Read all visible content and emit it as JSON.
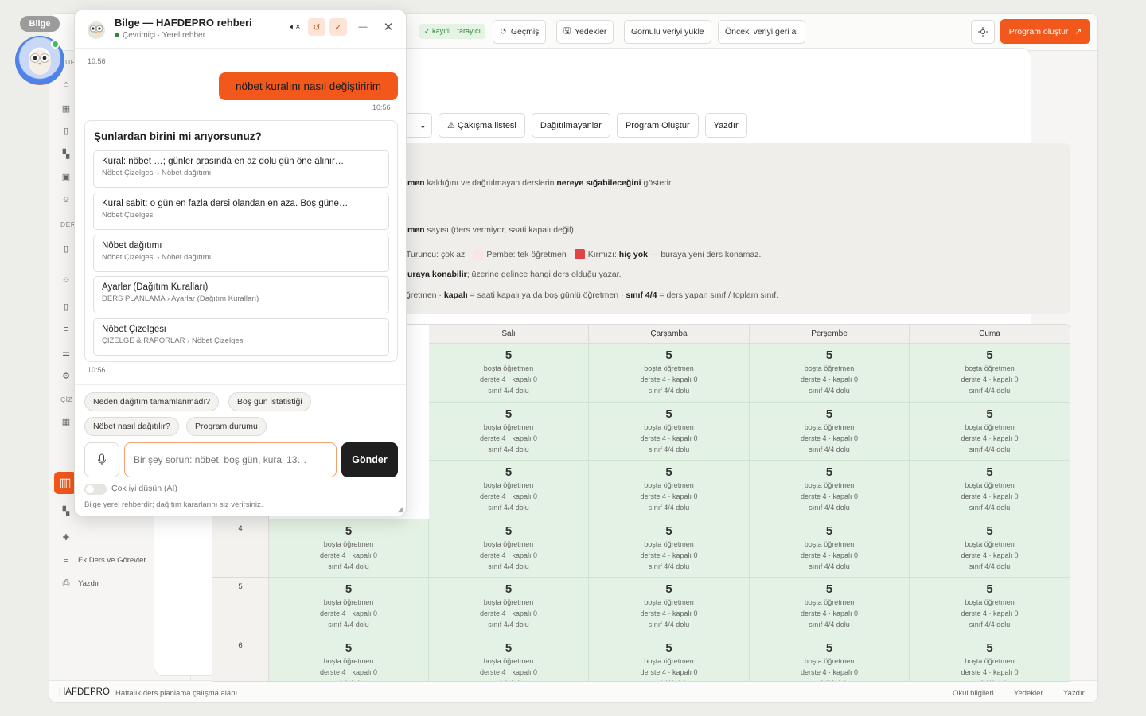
{
  "topbar": {
    "status_badge": "✓ kayıtlı · tarayıcı",
    "history": "Geçmiş",
    "backups": "Yedekler",
    "load_embedded": "Gömülü veriyi yükle",
    "restore_previous": "Önceki veriyi geri al",
    "create_program": "Program oluştur"
  },
  "sidebar": {
    "section_der": "DER",
    "section_ciz": "ÇİZ",
    "section_up": "UP",
    "item_extra": "Ek Ders ve Görevler",
    "item_print": "Yazdır"
  },
  "toolbar": {
    "conflicts": "⚠ Çakışma listesi",
    "undistributed": "Dağıtılmayanlar",
    "create_program": "Program Oluştur",
    "print": "Yazdır"
  },
  "info": {
    "line1_bold1": "men",
    "line1_text": " kaldığını ve dağıtılmayan derslerin ",
    "line1_bold2": "nereye sığabileceğini",
    "line1_end": " gösterir.",
    "line2_bold": "men",
    "line2_text": " sayısı (ders vermiyor, saati kapalı değil).",
    "legend_orange": "Turuncu: çok az",
    "legend_pink": "Pembe: tek öğretmen",
    "legend_red_prefix": "Kırmızı: ",
    "legend_red_bold": "hiç yok",
    "legend_red_text": " — buraya yeni ders konamaz.",
    "line4_bold": "uraya konabilir",
    "line4_text": "; üzerine gelince hangi ders olduğu yazar.",
    "line5_a": "ğretmen · ",
    "line5_b": "kapalı",
    "line5_c": " = saati kapalı ya da boş günlü öğretmen · ",
    "line5_d": "sınıf 4/4",
    "line5_e": " = ders yapan sınıf / toplam sınıf."
  },
  "grid": {
    "days": [
      "Salı",
      "Çarşamba",
      "Perşembe",
      "Cuma"
    ],
    "row_labels": [
      "",
      "",
      "",
      "4",
      "5",
      "6"
    ],
    "cell_value": "5",
    "cell_line1": "boşta öğretmen",
    "cell_line2": "derste 4 · kapalı 0",
    "cell_line3": "sınıf 4/4 dolu"
  },
  "footer": {
    "brand": "HAFDEPRO",
    "subtitle": "Haftalık ders planlama çalışma alanı",
    "link_school": "Okul bilgileri",
    "link_backups": "Yedekler",
    "link_print": "Yazdır"
  },
  "assistant_tag": "Bilge",
  "chat": {
    "title": "Bilge — HAFDEPRO rehberi",
    "status_online": "Çevrimiçi",
    "status_sub": " · Yerel rehber",
    "ts_top": "10:56",
    "user_message": "nöbet kuralını nasıl değiştiririm",
    "ts_user": "10:56",
    "suggest_title": "Şunlardan birini mi arıyorsunuz?",
    "suggestions": [
      {
        "title": "Kural: nöbet …; günler arasında en az dolu gün öne alınır…",
        "path": "Nöbet Çizelgesi › Nöbet dağıtımı"
      },
      {
        "title": "Kural sabit: o gün en fazla dersi olandan en aza. Boş güne…",
        "path": "Nöbet Çizelgesi"
      },
      {
        "title": "Nöbet dağıtımı",
        "path": "Nöbet Çizelgesi › Nöbet dağıtımı"
      },
      {
        "title": "Ayarlar (Dağıtım Kuralları)",
        "path": "DERS PLANLAMA › Ayarlar (Dağıtım Kuralları)"
      },
      {
        "title": "Nöbet Çizelgesi",
        "path": "ÇİZELGE & RAPORLAR › Nöbet Çizelgesi"
      }
    ],
    "ts_sugg": "10:56",
    "chips": [
      "Neden dağıtım tamamlanmadı?",
      "Boş gün istatistiği",
      "Nöbet nasıl dağıtılır?",
      "Program durumu"
    ],
    "input_placeholder": "Bir şey sorun: nöbet, boş gün, kural 13…",
    "send": "Gönder",
    "toggle_label": "Çok iyi düşün (AI)",
    "disclaimer": "Bilge yerel rehberdir; dağıtım kararlarını siz verirsiniz."
  },
  "colors": {
    "accent": "#f2571b",
    "cell_green": "#e3f2e4",
    "online": "#2f8a3d"
  }
}
